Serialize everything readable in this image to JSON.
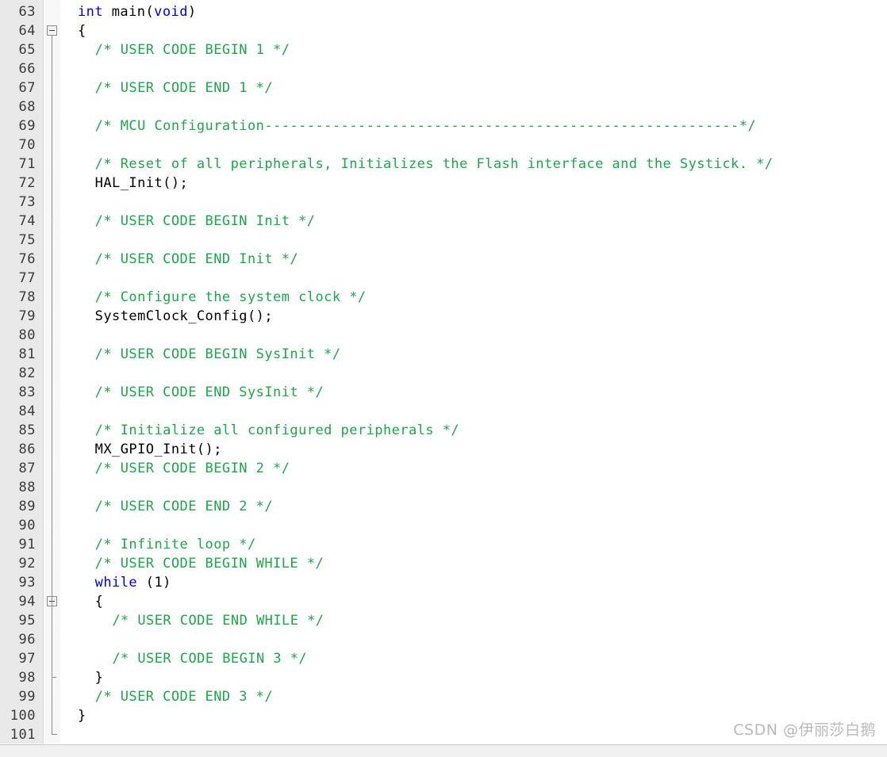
{
  "editor": {
    "language": "c",
    "first_visible_line": 63,
    "last_visible_line": 101,
    "line_height_px": 24,
    "colors": {
      "background": "#ffffff",
      "gutter_background": "#e9e9e9",
      "line_number": "#3b3b3b",
      "keyword": "#0000d0",
      "comment": "#1ea64a",
      "plain_text": "#000000",
      "fold_marker": "#8c8c8c",
      "watermark": "#b9b9b9"
    },
    "fold_markers": [
      {
        "line": 64,
        "type": "collapse-box"
      },
      {
        "line": 94,
        "type": "collapse-box"
      },
      {
        "line": 98,
        "type": "tick"
      },
      {
        "line": 101,
        "type": "end-corner"
      }
    ],
    "lines": [
      {
        "n": "63",
        "indent": 0,
        "tokens": [
          {
            "t": "kw",
            "v": "int"
          },
          {
            "t": "txt",
            "v": " main("
          },
          {
            "t": "kw",
            "v": "void"
          },
          {
            "t": "txt",
            "v": ")"
          }
        ]
      },
      {
        "n": "64",
        "indent": 0,
        "tokens": [
          {
            "t": "txt",
            "v": "{"
          }
        ]
      },
      {
        "n": "65",
        "indent": 2,
        "tokens": [
          {
            "t": "com",
            "v": "/* USER CODE BEGIN 1 */"
          }
        ]
      },
      {
        "n": "66",
        "indent": 0,
        "tokens": []
      },
      {
        "n": "67",
        "indent": 2,
        "tokens": [
          {
            "t": "com",
            "v": "/* USER CODE END 1 */"
          }
        ]
      },
      {
        "n": "68",
        "indent": 0,
        "tokens": []
      },
      {
        "n": "69",
        "indent": 2,
        "tokens": [
          {
            "t": "com",
            "v": "/* MCU Configuration--------------------------------------------------------*/"
          }
        ]
      },
      {
        "n": "70",
        "indent": 0,
        "tokens": []
      },
      {
        "n": "71",
        "indent": 2,
        "tokens": [
          {
            "t": "com",
            "v": "/* Reset of all peripherals, Initializes the Flash interface and the Systick. */"
          }
        ]
      },
      {
        "n": "72",
        "indent": 2,
        "tokens": [
          {
            "t": "txt",
            "v": "HAL_Init();"
          }
        ]
      },
      {
        "n": "73",
        "indent": 0,
        "tokens": []
      },
      {
        "n": "74",
        "indent": 2,
        "tokens": [
          {
            "t": "com",
            "v": "/* USER CODE BEGIN Init */"
          }
        ]
      },
      {
        "n": "75",
        "indent": 0,
        "tokens": []
      },
      {
        "n": "76",
        "indent": 2,
        "tokens": [
          {
            "t": "com",
            "v": "/* USER CODE END Init */"
          }
        ]
      },
      {
        "n": "77",
        "indent": 0,
        "tokens": []
      },
      {
        "n": "78",
        "indent": 2,
        "tokens": [
          {
            "t": "com",
            "v": "/* Configure the system clock */"
          }
        ]
      },
      {
        "n": "79",
        "indent": 2,
        "tokens": [
          {
            "t": "txt",
            "v": "SystemClock_Config();"
          }
        ]
      },
      {
        "n": "80",
        "indent": 0,
        "tokens": []
      },
      {
        "n": "81",
        "indent": 2,
        "tokens": [
          {
            "t": "com",
            "v": "/* USER CODE BEGIN SysInit */"
          }
        ]
      },
      {
        "n": "82",
        "indent": 0,
        "tokens": []
      },
      {
        "n": "83",
        "indent": 2,
        "tokens": [
          {
            "t": "com",
            "v": "/* USER CODE END SysInit */"
          }
        ]
      },
      {
        "n": "84",
        "indent": 0,
        "tokens": []
      },
      {
        "n": "85",
        "indent": 2,
        "tokens": [
          {
            "t": "com",
            "v": "/* Initialize all configured peripherals */"
          }
        ]
      },
      {
        "n": "86",
        "indent": 2,
        "tokens": [
          {
            "t": "txt",
            "v": "MX_GPIO_Init();"
          }
        ]
      },
      {
        "n": "87",
        "indent": 2,
        "tokens": [
          {
            "t": "com",
            "v": "/* USER CODE BEGIN 2 */"
          }
        ]
      },
      {
        "n": "88",
        "indent": 0,
        "tokens": []
      },
      {
        "n": "89",
        "indent": 2,
        "tokens": [
          {
            "t": "com",
            "v": "/* USER CODE END 2 */"
          }
        ]
      },
      {
        "n": "90",
        "indent": 0,
        "tokens": []
      },
      {
        "n": "91",
        "indent": 2,
        "tokens": [
          {
            "t": "com",
            "v": "/* Infinite loop */"
          }
        ]
      },
      {
        "n": "92",
        "indent": 2,
        "tokens": [
          {
            "t": "com",
            "v": "/* USER CODE BEGIN WHILE */"
          }
        ]
      },
      {
        "n": "93",
        "indent": 2,
        "tokens": [
          {
            "t": "kw",
            "v": "while"
          },
          {
            "t": "txt",
            "v": " (1)"
          }
        ]
      },
      {
        "n": "94",
        "indent": 2,
        "tokens": [
          {
            "t": "txt",
            "v": "{"
          }
        ]
      },
      {
        "n": "95",
        "indent": 4,
        "tokens": [
          {
            "t": "com",
            "v": "/* USER CODE END WHILE */"
          }
        ]
      },
      {
        "n": "96",
        "indent": 0,
        "tokens": []
      },
      {
        "n": "97",
        "indent": 4,
        "tokens": [
          {
            "t": "com",
            "v": "/* USER CODE BEGIN 3 */"
          }
        ]
      },
      {
        "n": "98",
        "indent": 2,
        "tokens": [
          {
            "t": "txt",
            "v": "}"
          }
        ]
      },
      {
        "n": "99",
        "indent": 2,
        "tokens": [
          {
            "t": "com",
            "v": "/* USER CODE END 3 */"
          }
        ]
      },
      {
        "n": "100",
        "indent": 0,
        "tokens": [
          {
            "t": "txt",
            "v": "}"
          }
        ]
      },
      {
        "n": "101",
        "indent": 0,
        "tokens": []
      }
    ]
  },
  "watermark": {
    "text": "CSDN @伊丽莎白鹅"
  }
}
